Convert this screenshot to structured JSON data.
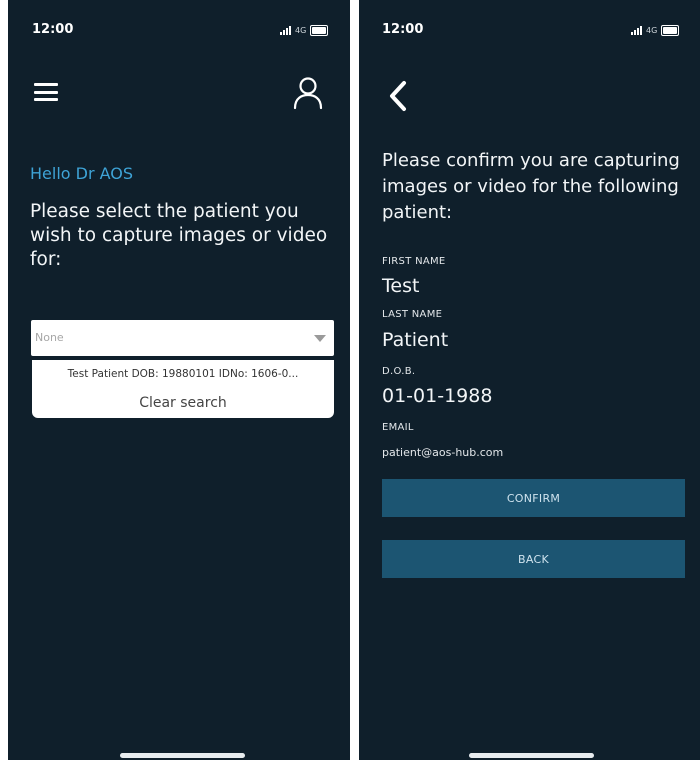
{
  "colors": {
    "background": "#0f1f2b",
    "accent": "#3ea3d6",
    "button": "#1c5572",
    "text": "#f2f5f7"
  },
  "status_bar": {
    "time": "12:00",
    "network": "4G",
    "icons": [
      "signal-icon",
      "battery-icon"
    ]
  },
  "select_screen": {
    "menu_icon": "hamburger-menu-icon",
    "profile_icon": "user-icon",
    "greeting": "Hello Dr AOS",
    "prompt": "Please select the patient you wish to capture images or video for:",
    "dropdown": {
      "selected": "None",
      "options": [
        "Test Patient DOB: 19880101 IDNo: 1606-0..."
      ],
      "clear_label": "Clear search"
    }
  },
  "confirm_screen": {
    "back_icon": "chevron-left-icon",
    "prompt": "Please confirm you are capturing images or video for the following patient:",
    "fields": {
      "first_name_label": "FIRST NAME",
      "first_name": "Test",
      "last_name_label": "LAST NAME",
      "last_name": "Patient",
      "dob_label": "D.O.B.",
      "dob": "01-01-1988",
      "email_label": "EMAIL",
      "email": "patient@aos-hub.com"
    },
    "confirm_label": "CONFIRM",
    "back_label": "BACK"
  }
}
